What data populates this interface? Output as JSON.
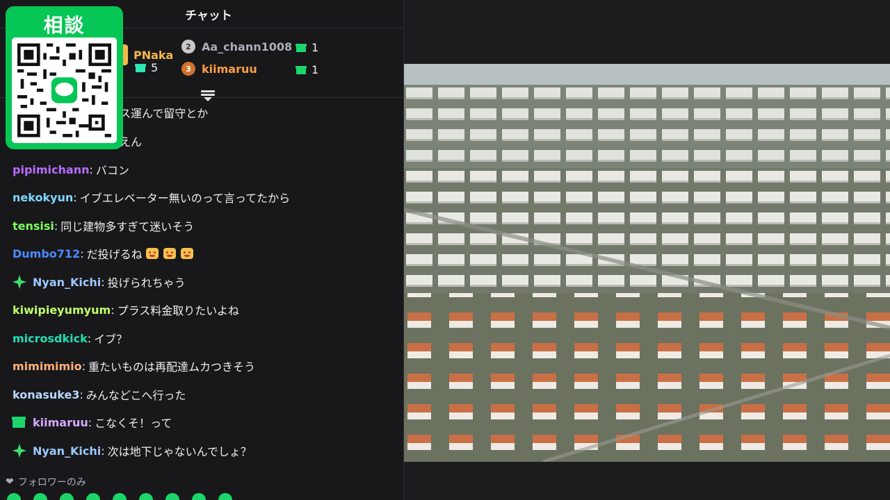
{
  "chat": {
    "title": "チャット",
    "leaderboard": [
      {
        "rank": "1",
        "name": "PNaka",
        "gifts": "5",
        "name_color": "#f5b84b"
      },
      {
        "rank": "2",
        "name": "Aa_chann1008",
        "gifts": "1",
        "name_color": "#adadb8"
      },
      {
        "rank": "3",
        "name": "kiimaruu",
        "gifts": "1",
        "name_color": "#ff9f43"
      }
    ],
    "messages": [
      {
        "user": "",
        "text": "ス運んで留守とか",
        "color": "#efeff1",
        "badge": ""
      },
      {
        "user": "",
        "text": "えん",
        "color": "#efeff1",
        "badge": ""
      },
      {
        "user": "pipimichann",
        "text": "バコン",
        "color": "#b86cff",
        "badge": ""
      },
      {
        "user": "nekokyun",
        "text": "イブエレベーター無いのって言ってたから",
        "color": "#7fd7ff",
        "badge": ""
      },
      {
        "user": "tensisi",
        "text": "同じ建物多すぎて迷いそう",
        "color": "#7dff5a",
        "badge": ""
      },
      {
        "user": "Dumbo712",
        "text": "だ投げるね",
        "color": "#4a8bff",
        "badge": "",
        "emotes": 3
      },
      {
        "user": "Nyan_Kichi",
        "text": "投げられちゃう",
        "color": "#9ec9ff",
        "badge": "sparkle-icon"
      },
      {
        "user": "kiwipieyumyum",
        "text": "プラス料金取りたいよね",
        "color": "#bfff6a",
        "badge": ""
      },
      {
        "user": "microsdkick",
        "text": "イブ？",
        "color": "#1fe0b0",
        "badge": ""
      },
      {
        "user": "mimimimio",
        "text": "重たいものは再配達ムカつきそう",
        "color": "#ffb07a",
        "badge": ""
      },
      {
        "user": "konasuke3",
        "text": "みんなどこへ行った",
        "color": "#b8d8ff",
        "badge": ""
      },
      {
        "user": "kiimaruu",
        "text": "こなくそ！って",
        "color": "#d8a8ff",
        "badge": "gift-icon"
      },
      {
        "user": "Nyan_Kichi",
        "text": "次は地下じゃないんでしょ？",
        "color": "#9ec9ff",
        "badge": "sparkle-icon"
      }
    ],
    "follower_only": "フォロワーのみ"
  },
  "qr_card": {
    "title": "相談",
    "color": "#06c755"
  },
  "video": {
    "description_icon": "aerial-city-image"
  }
}
